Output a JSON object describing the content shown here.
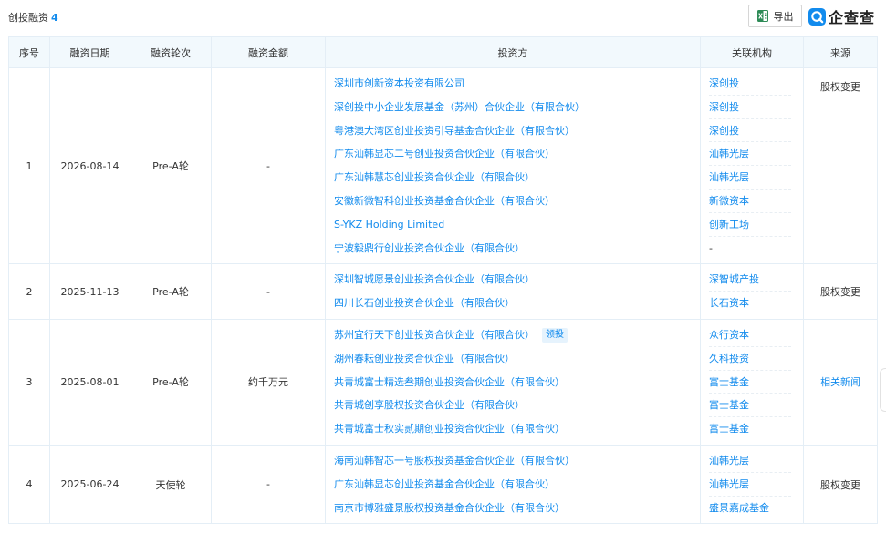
{
  "header": {
    "title": "创投融资",
    "count": "4",
    "export_label": "导出",
    "brand_name": "企查查",
    "brand_color": "#128bed",
    "excel_icon": "excel-icon"
  },
  "table": {
    "columns": [
      "序号",
      "融资日期",
      "融资轮次",
      "融资金额",
      "投资方",
      "关联机构",
      "来源"
    ],
    "rows": [
      {
        "index": "1",
        "date": "2026-08-14",
        "round": "Pre-A轮",
        "amount": "-",
        "investors": [
          "深圳市创新资本投资有限公司",
          "深创投中小企业发展基金（苏州）合伙企业（有限合伙）",
          "粤港澳大湾区创业投资引导基金合伙企业（有限合伙）",
          "广东汕韩显芯二号创业投资合伙企业（有限合伙）",
          "广东汕韩慧芯创业投资合伙企业（有限合伙）",
          "安徽新微智科创业投资基金合伙企业（有限合伙）",
          "S-YKZ Holding Limited",
          "宁波毅鼎行创业投资合伙企业（有限合伙）"
        ],
        "orgs": [
          "深创投",
          "深创投",
          "深创投",
          "汕韩光层",
          "汕韩光层",
          "新微资本",
          "创新工场",
          "-"
        ],
        "source": "股权变更",
        "source_is_link": false
      },
      {
        "index": "2",
        "date": "2025-11-13",
        "round": "Pre-A轮",
        "amount": "-",
        "investors": [
          "深圳智城愿景创业投资合伙企业（有限合伙）",
          "四川长石创业投资合伙企业（有限合伙）"
        ],
        "orgs": [
          "深智城产投",
          "长石资本"
        ],
        "source": "股权变更",
        "source_is_link": false
      },
      {
        "index": "3",
        "date": "2025-08-01",
        "round": "Pre-A轮",
        "amount": "约千万元",
        "investors": [
          "苏州宜行天下创业投资合伙企业（有限合伙）",
          "湖州春耘创业投资合伙企业（有限合伙）",
          "共青城富士精选叁期创业投资合伙企业（有限合伙）",
          "共青城创享股权投资合伙企业（有限合伙）",
          "共青城富士秋实贰期创业投资合伙企业（有限合伙）"
        ],
        "lead_tag": "领投",
        "orgs": [
          "众行资本",
          "久科投资",
          "富士基金",
          "富士基金",
          "富士基金"
        ],
        "source": "相关新闻",
        "source_is_link": true
      },
      {
        "index": "4",
        "date": "2025-06-24",
        "round": "天使轮",
        "amount": "-",
        "investors": [
          "海南汕韩智芯一号股权投资基金合伙企业（有限合伙）",
          "广东汕韩显芯创业投资基金合伙企业（有限合伙）",
          "南京市博雅盛景股权投资基金合伙企业（有限合伙）"
        ],
        "orgs": [
          "汕韩光层",
          "汕韩光层",
          "盛景嘉成基金"
        ],
        "source": "股权变更",
        "source_is_link": false
      }
    ]
  }
}
